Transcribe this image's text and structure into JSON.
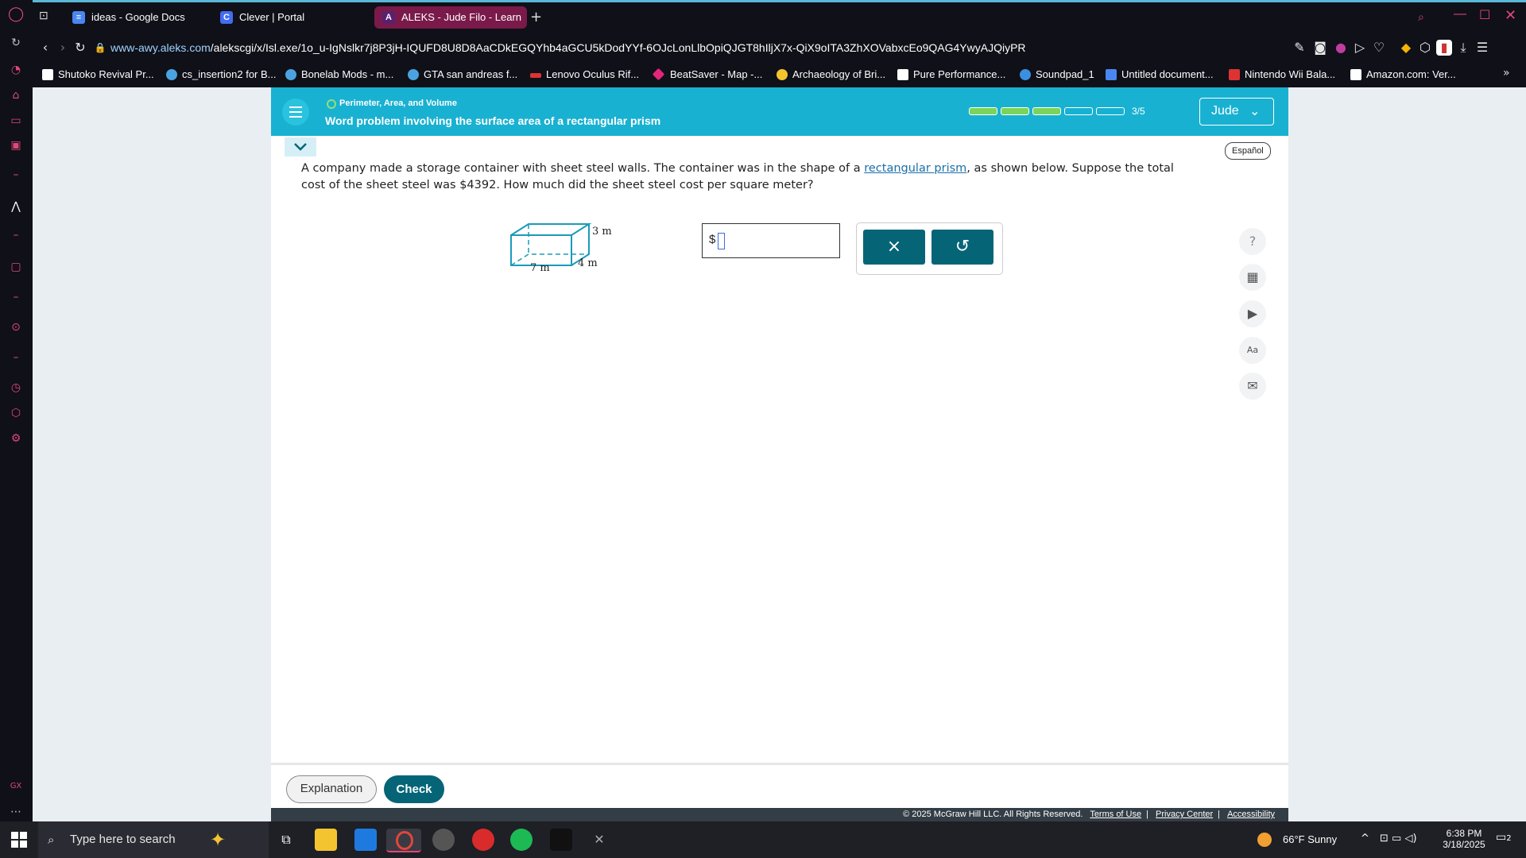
{
  "browser": {
    "tabs": [
      {
        "label": "ideas - Google Docs",
        "icon": "docs-icon",
        "color": "#4a86f0"
      },
      {
        "label": "Clever | Portal",
        "icon": "clever-icon",
        "color": "#436cf2"
      },
      {
        "label": "ALEKS - Jude Filo - Learn",
        "icon": "aleks-icon",
        "color": "#7a1a4a",
        "active": true
      }
    ],
    "url_host": "www-awy.aleks.com",
    "url_path": "/alekscgi/x/Isl.exe/1o_u-IgNslkr7j8P3jH-IQUFD8U8D8AaCDkEGQYhb4aGCU5kDodYYf-6OJcLonLlbOpiQJGT8hIljX7x-QiX9oITA3ZhXOVabxcEo9QAG4YwyAJQiyPR",
    "bookmarks": [
      "Shutoko Revival Pr...",
      "cs_insertion2 for B...",
      "Bonelab Mods - m...",
      "GTA san andreas f...",
      "Lenovo Oculus Rif...",
      "BeatSaver - Map -...",
      "Archaeology of Bri...",
      "Pure Performance...",
      "Soundpad_1",
      "Untitled document...",
      "Nintendo Wii Bala...",
      "Amazon.com: Ver..."
    ]
  },
  "aleks": {
    "topic": "Perimeter, Area, and Volume",
    "problem_title": "Word problem involving the surface area of a rectangular prism",
    "progress_label": "3/5",
    "progress_filled": 3,
    "progress_total": 5,
    "user_name": "Jude",
    "espanol": "Español",
    "question_part1": "A company made a storage container with sheet steel walls. The container was in the shape of a ",
    "question_link": "rectangular prism",
    "question_part2": ", as shown below. Suppose the total cost of the sheet steel was $4392. How much did the sheet steel cost per square meter?",
    "figure": {
      "height_label": "3 m",
      "length_label": "7 m",
      "width_label": "4 m"
    },
    "answer_prefix": "$",
    "clear_label": "×",
    "undo_label": "↺",
    "explanation_label": "Explanation",
    "check_label": "Check",
    "copyright": "© 2025 McGraw Hill LLC. All Rights Reserved.",
    "footer_links": [
      "Terms of Use",
      "Privacy Center",
      "Accessibility"
    ],
    "accent_color": "#19b1d1",
    "button_color": "#056577"
  },
  "taskbar": {
    "search_placeholder": "Type here to search",
    "weather": "66°F  Sunny",
    "time": "6:38 PM",
    "date": "3/18/2025",
    "notifications": "2"
  }
}
